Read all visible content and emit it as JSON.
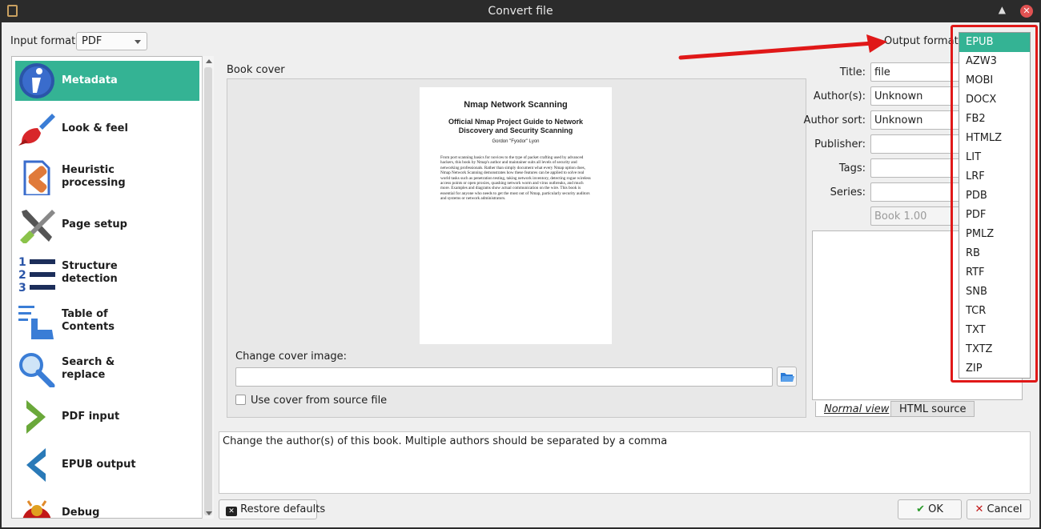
{
  "window": {
    "title": "Convert file"
  },
  "input_format": {
    "label": "Input format:",
    "value": "PDF"
  },
  "output_format": {
    "label": "Output format:",
    "selected": "EPUB",
    "options": [
      "EPUB",
      "AZW3",
      "MOBI",
      "DOCX",
      "FB2",
      "HTMLZ",
      "LIT",
      "LRF",
      "PDB",
      "PDF",
      "PMLZ",
      "RB",
      "RTF",
      "SNB",
      "TCR",
      "TXT",
      "TXTZ",
      "ZIP"
    ]
  },
  "sidebar": {
    "items": [
      {
        "label": "Metadata",
        "icon": "info-icon"
      },
      {
        "label": "Look & feel",
        "icon": "paintbrush-icon"
      },
      {
        "label": "Heuristic\nprocessing",
        "icon": "bandage-icon"
      },
      {
        "label": "Page setup",
        "icon": "wrench-screwdriver-icon"
      },
      {
        "label": "Structure\ndetection",
        "icon": "numbered-list-icon"
      },
      {
        "label": "Table of\nContents",
        "icon": "toc-hand-icon"
      },
      {
        "label": "Search &\nreplace",
        "icon": "magnifier-icon"
      },
      {
        "label": "PDF input",
        "icon": "chevron-right-icon"
      },
      {
        "label": "EPUB output",
        "icon": "chevron-left-icon"
      },
      {
        "label": "Debug",
        "icon": "bug-icon"
      }
    ]
  },
  "book_cover": {
    "label": "Book cover",
    "cover_title": "Nmap Network Scanning",
    "cover_subtitle": "Official Nmap Project Guide to Network Discovery and Security Scanning",
    "cover_author": "Gordon \"Fyodor\" Lyon",
    "cover_blurb": "From port scanning basics for novices to the type of packet crafting used by advanced hackers, this book by Nmap's author and maintainer suits all levels of security and networking professionals. Rather than simply document what every Nmap option does, Nmap Network Scanning demonstrates how these features can be applied to solve real world tasks such as penetration testing, taking network inventory, detecting rogue wireless access points or open proxies, quashing network worm and virus outbreaks, and much more. Examples and diagrams show actual communication on the wire. This book is essential for anyone who needs to get the most out of Nmap, particularly security auditors and systems or network administrators.",
    "change_label": "Change cover image:",
    "change_value": "",
    "use_source_label": "Use cover from source file"
  },
  "metadata": {
    "title_label": "Title:",
    "title_value": "file",
    "authors_label": "Author(s):",
    "authors_value": "Unknown",
    "author_sort_label": "Author sort:",
    "author_sort_value": "Unknown",
    "publisher_label": "Publisher:",
    "publisher_value": "",
    "tags_label": "Tags:",
    "tags_value": "",
    "series_label": "Series:",
    "series_value": "",
    "series_index_placeholder": "Book 1.00"
  },
  "comments": {
    "tab_normal": "Normal view",
    "tab_html": "HTML source"
  },
  "help_text": "Change the author(s) of this book. Multiple authors should be separated by a comma",
  "buttons": {
    "restore": "Restore defaults",
    "ok": "OK",
    "cancel": "Cancel"
  },
  "colors": {
    "accent": "#34b394",
    "annotation_red": "#e01818",
    "titlebar": "#2b2b2b"
  }
}
